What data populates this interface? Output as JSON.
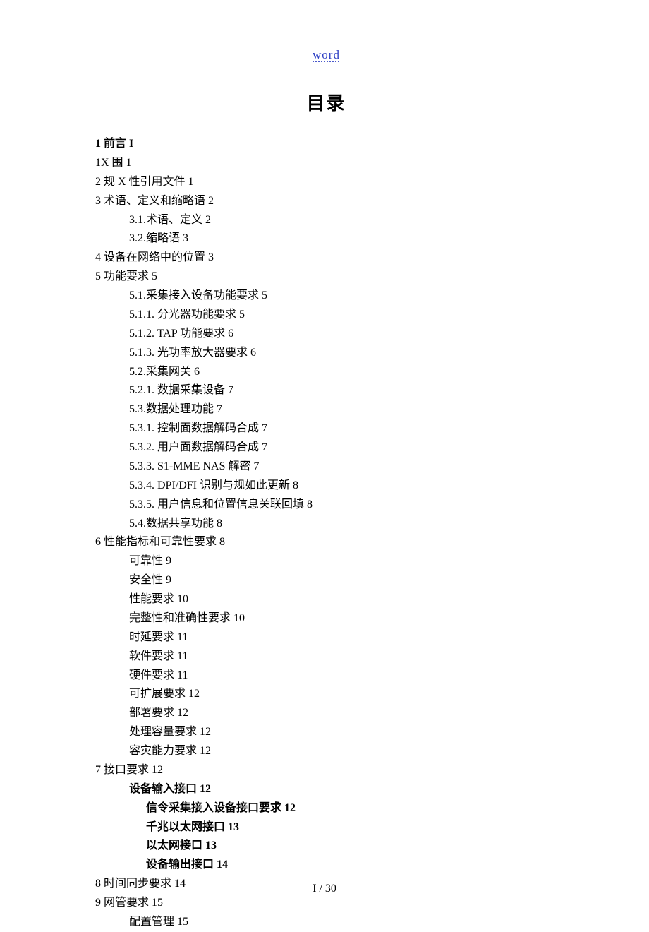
{
  "header": {
    "label": "word"
  },
  "title": "目录",
  "toc": [
    {
      "level": 0,
      "bold": true,
      "text": "1 前言 I"
    },
    {
      "level": 0,
      "bold": false,
      "text": "1X 围 1"
    },
    {
      "level": 0,
      "bold": false,
      "text": "2 规 X 性引用文件 1"
    },
    {
      "level": 0,
      "bold": false,
      "text": "3 术语、定义和缩略语 2"
    },
    {
      "level": 1,
      "bold": false,
      "text": "3.1.术语、定义 2"
    },
    {
      "level": 1,
      "bold": false,
      "text": "3.2.缩略语 3"
    },
    {
      "level": 0,
      "bold": false,
      "text": "4 设备在网络中的位置 3"
    },
    {
      "level": 0,
      "bold": false,
      "text": "5 功能要求 5"
    },
    {
      "level": 1,
      "bold": false,
      "text": "5.1.采集接入设备功能要求 5"
    },
    {
      "level": 1,
      "bold": false,
      "text": "5.1.1. 分光器功能要求 5"
    },
    {
      "level": 1,
      "bold": false,
      "text": "5.1.2. TAP 功能要求 6"
    },
    {
      "level": 1,
      "bold": false,
      "text": "5.1.3. 光功率放大器要求 6"
    },
    {
      "level": 1,
      "bold": false,
      "text": "5.2.采集网关 6"
    },
    {
      "level": 1,
      "bold": false,
      "text": "5.2.1. 数据采集设备 7"
    },
    {
      "level": 1,
      "bold": false,
      "text": "5.3.数据处理功能 7"
    },
    {
      "level": 1,
      "bold": false,
      "text": "5.3.1. 控制面数据解码合成 7"
    },
    {
      "level": 1,
      "bold": false,
      "text": "5.3.2. 用户面数据解码合成 7"
    },
    {
      "level": 1,
      "bold": false,
      "text": "5.3.3. S1-MME NAS  解密 7"
    },
    {
      "level": 1,
      "bold": false,
      "text": "5.3.4. DPI/DFI  识别与规如此更新 8"
    },
    {
      "level": 1,
      "bold": false,
      "text": "5.3.5. 用户信息和位置信息关联回填 8"
    },
    {
      "level": 1,
      "bold": false,
      "text": "5.4.数据共享功能 8"
    },
    {
      "level": 0,
      "bold": false,
      "text": "6 性能指标和可靠性要求 8"
    },
    {
      "level": 1,
      "bold": false,
      "text": "可靠性 9"
    },
    {
      "level": 1,
      "bold": false,
      "text": "安全性 9"
    },
    {
      "level": 1,
      "bold": false,
      "text": "性能要求 10"
    },
    {
      "level": 1,
      "bold": false,
      "text": "完整性和准确性要求 10"
    },
    {
      "level": 1,
      "bold": false,
      "text": "时延要求 11"
    },
    {
      "level": 1,
      "bold": false,
      "text": "软件要求 11"
    },
    {
      "level": 1,
      "bold": false,
      "text": "硬件要求 11"
    },
    {
      "level": 1,
      "bold": false,
      "text": "可扩展要求 12"
    },
    {
      "level": 1,
      "bold": false,
      "text": "部署要求 12"
    },
    {
      "level": 1,
      "bold": false,
      "text": "处理容量要求 12"
    },
    {
      "level": 1,
      "bold": false,
      "text": "容灾能力要求 12"
    },
    {
      "level": 0,
      "bold": false,
      "text": "7 接口要求 12"
    },
    {
      "level": 1,
      "bold": true,
      "text": "设备输入接口 12"
    },
    {
      "level": 2,
      "bold": true,
      "text": "信令采集接入设备接口要求 12"
    },
    {
      "level": 2,
      "bold": true,
      "text": "千兆以太网接口 13"
    },
    {
      "level": 2,
      "bold": true,
      "text": "以太网接口 13"
    },
    {
      "level": 2,
      "bold": true,
      "text": "设备输出接口 14"
    },
    {
      "level": 0,
      "bold": false,
      "text": "8 时间同步要求 14"
    },
    {
      "level": 0,
      "bold": false,
      "text": "9 网管要求 15"
    },
    {
      "level": 1,
      "bold": false,
      "text": "配置管理 15"
    }
  ],
  "footer": {
    "page_label": "I / 30"
  }
}
